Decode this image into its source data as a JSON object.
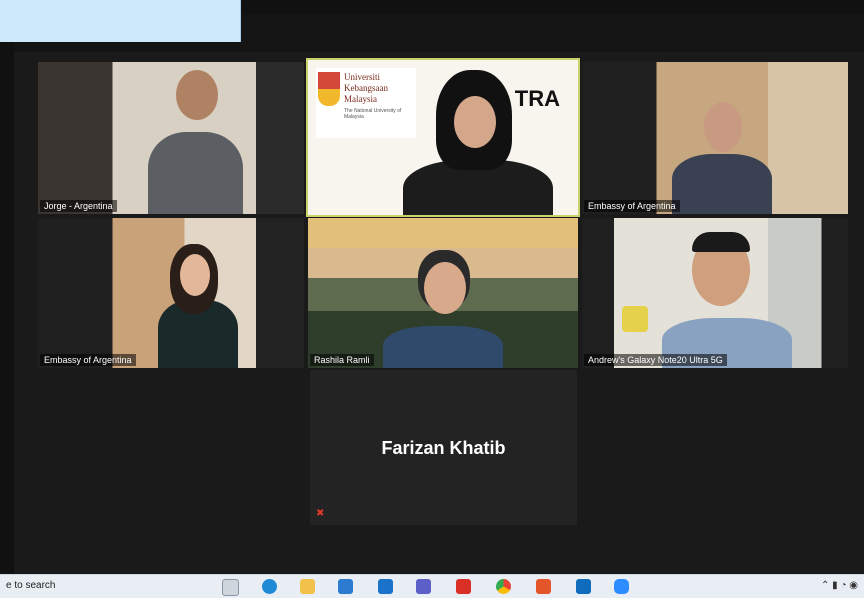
{
  "participants": [
    {
      "name": "Jorge - Argentina"
    },
    {
      "name": ""
    },
    {
      "name": "Embassy of Argentina"
    },
    {
      "name": "Embassy of Argentina"
    },
    {
      "name": "Rashila Ramli"
    },
    {
      "name": "Andrew's Galaxy Note20 Ultra 5G"
    }
  ],
  "center_logo": {
    "line1": "Universiti",
    "line2": "Kebangsaan",
    "line3": "Malaysia",
    "tag": "The National University of Malaysia",
    "partner_text": "TRA"
  },
  "avatar_tile": {
    "name": "Farizan Khatib"
  },
  "taskbar": {
    "search_text": "e to search"
  },
  "colors": {
    "active_speaker_border": "#c9d36a",
    "top_patch": "#cde9fb",
    "taskbar": "#e9eef4"
  },
  "taskbar_icons": [
    "task-view-icon",
    "edge-icon",
    "file-explorer-icon",
    "store-icon",
    "mail-icon",
    "teams-icon",
    "acrobat-icon",
    "chrome-icon",
    "office-icon",
    "outlook-icon",
    "zoom-icon"
  ]
}
